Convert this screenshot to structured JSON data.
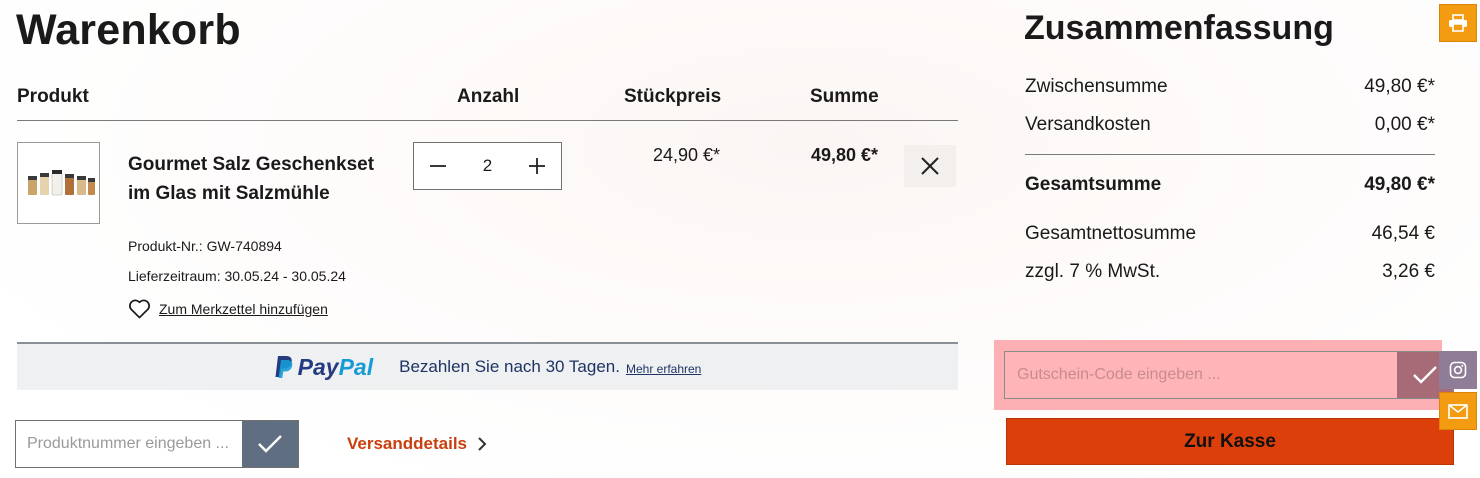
{
  "cart": {
    "title": "Warenkorb",
    "columns": {
      "product": "Produkt",
      "quantity": "Anzahl",
      "unit_price": "Stückpreis",
      "total": "Summe"
    },
    "item": {
      "name": "Gourmet Salz Geschenkset im Glas mit Salzmühle",
      "product_no": "Produkt-Nr.: GW-740894",
      "delivery": "Lieferzeitraum: 30.05.24 - 30.05.24",
      "wishlist_label": "Zum Merkzettel hinzufügen",
      "quantity": "2",
      "unit_price": "24,90 €*",
      "line_total": "49,80 €*",
      "image_icon": "salt-jars-product-image"
    },
    "paypal": {
      "logo_part1": "Pay",
      "logo_part2": "Pal",
      "text": "Bezahlen Sie nach 30 Tagen.",
      "more": "Mehr erfahren"
    },
    "product_number_input": {
      "placeholder": "Produktnummer eingeben ...",
      "value": ""
    },
    "shipping_link": "Versanddetails"
  },
  "summary": {
    "title": "Zusammenfassung",
    "subtotal_label": "Zwischensumme",
    "subtotal_value": "49,80 €*",
    "shipping_label": "Versandkosten",
    "shipping_value": "0,00 €*",
    "total_label": "Gesamtsumme",
    "total_value": "49,80 €*",
    "net_label": "Gesamtnettosumme",
    "net_value": "46,54 €",
    "vat_label": "zzgl. 7 % MwSt.",
    "vat_value": "3,26 €",
    "voucher": {
      "placeholder": "Gutschein-Code eingeben ...",
      "value": ""
    },
    "checkout_label": "Zur Kasse"
  },
  "colors": {
    "accent_orange": "#f39c12",
    "checkout_red": "#dc3f0a",
    "shipping_link": "#c9400e",
    "paypal_dark": "#253b80",
    "paypal_light": "#179bd7",
    "confirm_button": "#5f6e80",
    "voucher_highlight": "#fdb0b4"
  },
  "side_icons": [
    "printer-icon",
    "instagram-icon",
    "mail-icon"
  ]
}
